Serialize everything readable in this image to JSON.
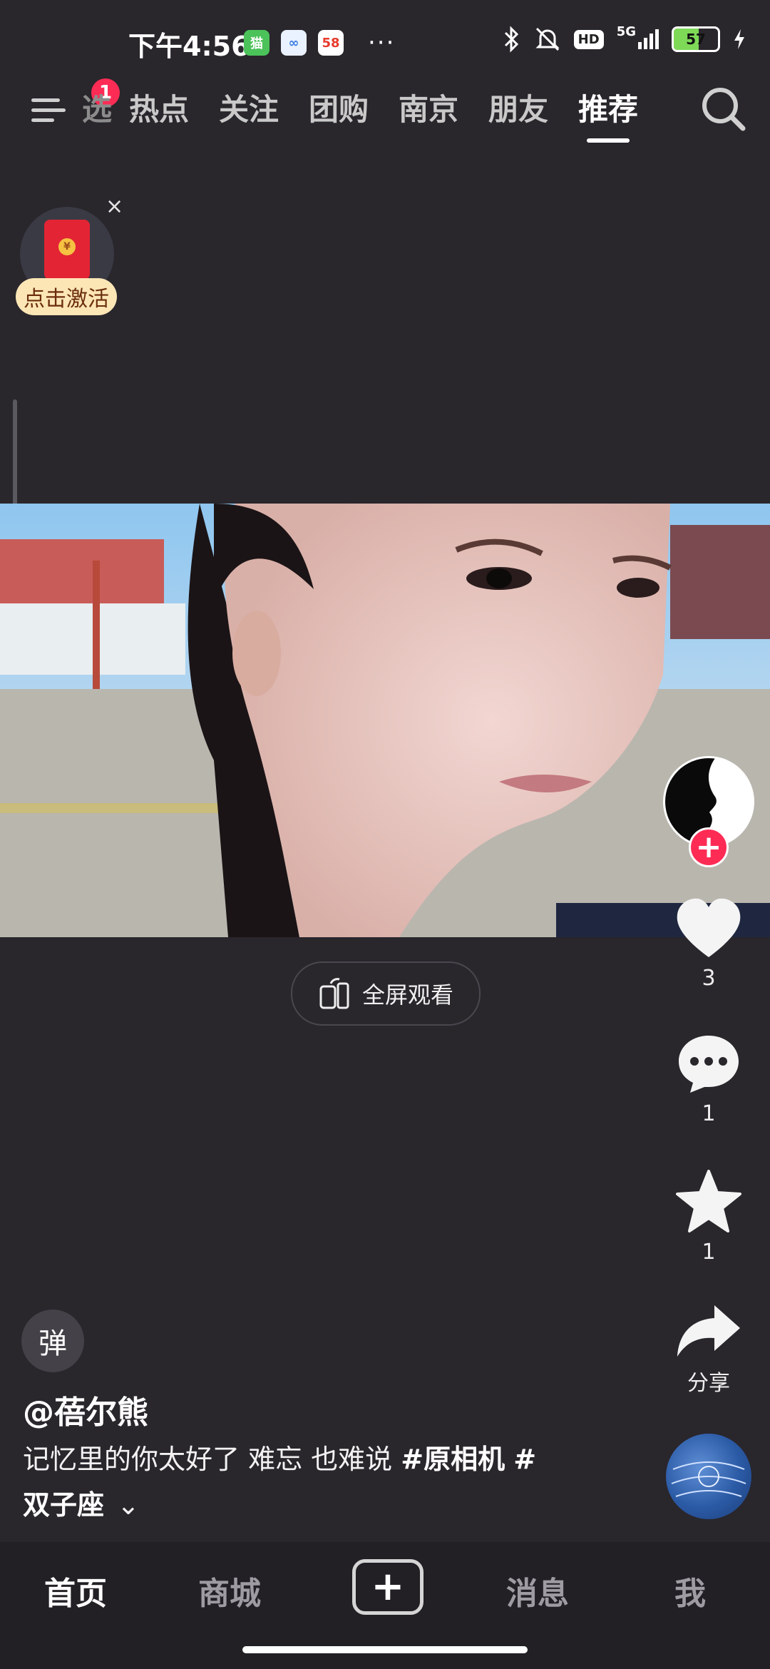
{
  "status_bar": {
    "time": "下午4:56",
    "app1": "猫",
    "app2": "∞",
    "app3": "58",
    "more": "···",
    "hd": "HD",
    "network": "5G",
    "battery": "57"
  },
  "top_nav": {
    "notification_count": "1",
    "tabs": [
      {
        "label": "选"
      },
      {
        "label": "热点"
      },
      {
        "label": "关注"
      },
      {
        "label": "团购"
      },
      {
        "label": "南京"
      },
      {
        "label": "朋友"
      },
      {
        "label": "推荐"
      }
    ],
    "active_tab": "推荐"
  },
  "promo": {
    "label": "点击激活",
    "close": "×",
    "coin": "¥"
  },
  "video": {
    "fullscreen_label": "全屏观看"
  },
  "actions": {
    "like_count": "3",
    "comment_count": "1",
    "favorite_count": "1",
    "share_label": "分享",
    "follow": "+"
  },
  "post": {
    "danmu": "弹",
    "author": "@蓓尔熊",
    "description_text": "记忆里的你太好了 难忘 也难说 ",
    "tag1": "#原相机",
    "tag2": "#",
    "tag3": "双子座",
    "expand": "⌄"
  },
  "bottom_bar": {
    "home": "首页",
    "mall": "商城",
    "create": "+",
    "messages": "消息",
    "me": "我"
  },
  "colors": {
    "background": "#29262c",
    "accent": "#fe2c55",
    "promo_bg": "#fde6b6"
  }
}
